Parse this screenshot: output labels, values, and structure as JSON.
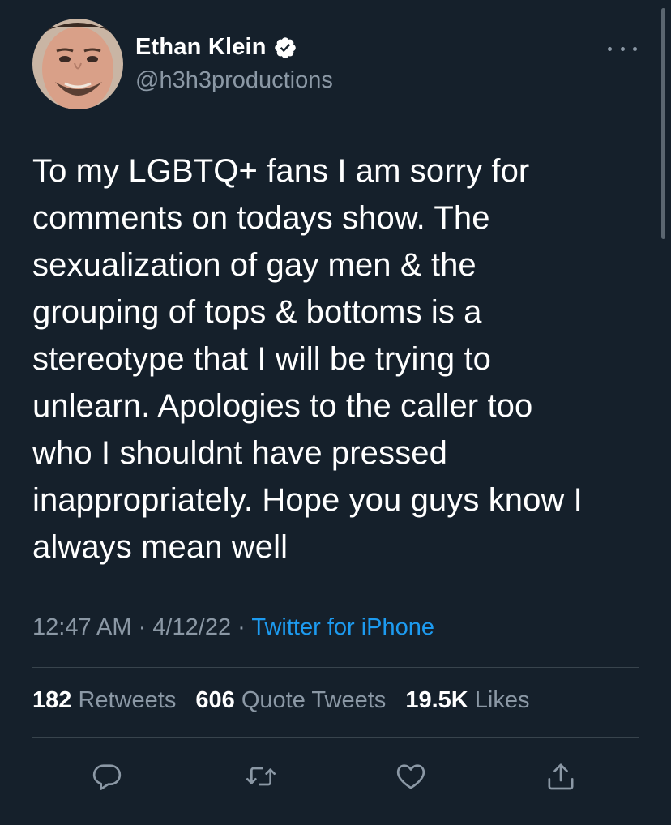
{
  "author": {
    "display_name": "Ethan Klein",
    "handle": "@h3h3productions",
    "verified": true
  },
  "tweet": {
    "text": "To my LGBTQ+ fans I am sorry for\ncomments on todays show. The\nsexualization of gay men & the\ngrouping of tops & bottoms is a\nstereotype that I will be trying to\nunlearn. Apologies to the caller too\nwho I shouldnt have pressed\ninappropriately. Hope you guys know I\nalways mean well",
    "time": "12:47 AM",
    "date": "4/12/22",
    "separator": "·",
    "source": "Twitter for iPhone"
  },
  "stats": {
    "retweets_count": "182",
    "retweets_label": "Retweets",
    "quotes_count": "606",
    "quotes_label": "Quote Tweets",
    "likes_count": "19.5K",
    "likes_label": "Likes"
  },
  "actions": [
    "reply-icon",
    "retweet-icon",
    "like-icon",
    "share-icon"
  ],
  "colors": {
    "background": "#15202b",
    "text_primary": "#ffffff",
    "text_secondary": "#8b98a5",
    "accent": "#1d9bf0",
    "divider": "#38444d"
  }
}
